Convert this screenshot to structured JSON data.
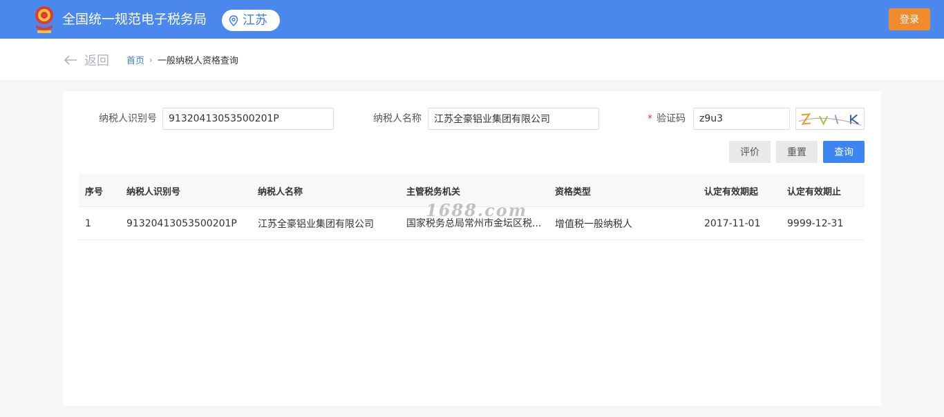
{
  "header": {
    "title": "全国统一规范电子税务局",
    "region": "江苏",
    "login_label": "登录",
    "brand_color": "#4a88ee",
    "login_color": "#f08a2c"
  },
  "nav": {
    "back_label": "返回",
    "breadcrumb_home": "首页",
    "breadcrumb_separator": "›",
    "breadcrumb_current": "一般纳税人资格查询"
  },
  "form": {
    "taxpayer_id_label": "纳税人识别号",
    "taxpayer_id_value": "91320413053500201P",
    "taxpayer_name_label": "纳税人名称",
    "taxpayer_name_value": "江苏全豪铝业集团有限公司",
    "captcha_required_mark": "*",
    "captcha_label": "验证码",
    "captcha_value": "z9u3",
    "evaluate_label": "评价",
    "reset_label": "重置",
    "query_label": "查询"
  },
  "table": {
    "columns": [
      "序号",
      "纳税人识别号",
      "纳税人名称",
      "主管税务机关",
      "资格类型",
      "认定有效期起",
      "认定有效期止"
    ],
    "rows": [
      [
        "1",
        "91320413053500201P",
        "江苏全豪铝业集团有限公司",
        "国家税务总局常州市金坛区税...",
        "增值税一般纳税人",
        "2017-11-01",
        "9999-12-31"
      ]
    ]
  },
  "watermark": "1688.com"
}
